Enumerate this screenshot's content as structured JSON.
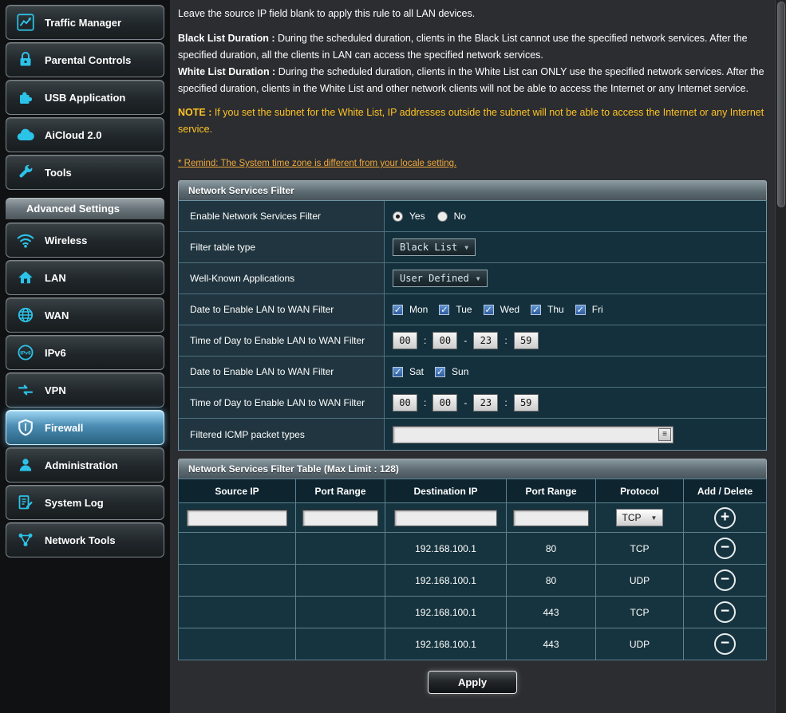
{
  "colors": {
    "accent_cyan": "#2cc3e8",
    "note_orange": "#ffc324",
    "remind_orange": "#f0a93c",
    "selected_item_blue": "#4c8db4"
  },
  "sidebar": {
    "top_items": [
      {
        "label": "Traffic Manager",
        "icon": "traffic-manager-icon"
      },
      {
        "label": "Parental Controls",
        "icon": "lock-icon"
      },
      {
        "label": "USB Application",
        "icon": "puzzle-icon"
      },
      {
        "label": "AiCloud 2.0",
        "icon": "cloud-icon"
      },
      {
        "label": "Tools",
        "icon": "wrench-icon"
      }
    ],
    "section_title": "Advanced Settings",
    "advanced_items": [
      {
        "label": "Wireless",
        "icon": "wifi-icon"
      },
      {
        "label": "LAN",
        "icon": "house-icon"
      },
      {
        "label": "WAN",
        "icon": "globe-icon"
      },
      {
        "label": "IPv6",
        "icon": "ipv6-icon"
      },
      {
        "label": "VPN",
        "icon": "vpn-icon"
      },
      {
        "label": "Firewall",
        "icon": "shield-icon",
        "selected": true
      },
      {
        "label": "Administration",
        "icon": "person-icon"
      },
      {
        "label": "System Log",
        "icon": "log-icon"
      },
      {
        "label": "Network Tools",
        "icon": "network-icon"
      }
    ]
  },
  "intro": {
    "lead": "Leave the source IP field blank to apply this rule to all LAN devices.",
    "black_term": "Black List Duration :",
    "black_desc": " During the scheduled duration, clients in the Black List cannot use the specified network services. After the specified duration, all the clients in LAN can access the specified network services.",
    "white_term": "White List Duration :",
    "white_desc": " During the scheduled duration, clients in the White List can ONLY use the specified network services. After the specified duration, clients in the White List and other network clients will not be able to access the Internet or any Internet service.",
    "note_term": "NOTE :",
    "note_desc": " If you set the subnet for the White List, IP addresses outside the subnet will not be able to access the Internet or any Internet service.",
    "remind_link": "* Remind: The System time zone is different from your locale setting."
  },
  "filter": {
    "panel_title": "Network Services Filter",
    "enable_label": "Enable Network Services Filter",
    "enable_yes": "Yes",
    "enable_no": "No",
    "filter_type_label": "Filter table type",
    "filter_type_value": "Black List",
    "apps_label": "Well-Known Applications",
    "apps_value": "User Defined",
    "date1_label": "Date to Enable LAN to WAN Filter",
    "days_weekday": [
      "Mon",
      "Tue",
      "Wed",
      "Thu",
      "Fri"
    ],
    "time1_label": "Time of Day to Enable LAN to WAN Filter",
    "time1": {
      "h1": "00",
      "m1": "00",
      "h2": "23",
      "m2": "59"
    },
    "date2_label": "Date to Enable LAN to WAN Filter",
    "days_weekend": [
      "Sat",
      "Sun"
    ],
    "time2_label": "Time of Day to Enable LAN to WAN Filter",
    "time2": {
      "h1": "00",
      "m1": "00",
      "h2": "23",
      "m2": "59"
    },
    "icmp_label": "Filtered ICMP packet types",
    "icmp_value": "",
    "colon": ":",
    "dash": "-",
    "dropdown_arrow": "▼",
    "check_glyph": "✓",
    "kb_button_glyph": "≡"
  },
  "table": {
    "panel_title": "Network Services Filter Table (Max Limit : 128)",
    "headers": [
      "Source IP",
      "Port Range",
      "Destination IP",
      "Port Range",
      "Protocol",
      "Add / Delete"
    ],
    "protocol_value": "TCP",
    "add_glyph": "+",
    "delete_glyph": "−",
    "input_row": {
      "source_ip": "",
      "port_range": "",
      "dest_ip": "",
      "dest_port": ""
    },
    "rows": [
      {
        "source_ip": "",
        "port_range": "",
        "dest_ip": "192.168.100.1",
        "dest_port": "80",
        "protocol": "TCP"
      },
      {
        "source_ip": "",
        "port_range": "",
        "dest_ip": "192.168.100.1",
        "dest_port": "80",
        "protocol": "UDP"
      },
      {
        "source_ip": "",
        "port_range": "",
        "dest_ip": "192.168.100.1",
        "dest_port": "443",
        "protocol": "TCP"
      },
      {
        "source_ip": "",
        "port_range": "",
        "dest_ip": "192.168.100.1",
        "dest_port": "443",
        "protocol": "UDP"
      }
    ]
  },
  "apply_label": "Apply"
}
